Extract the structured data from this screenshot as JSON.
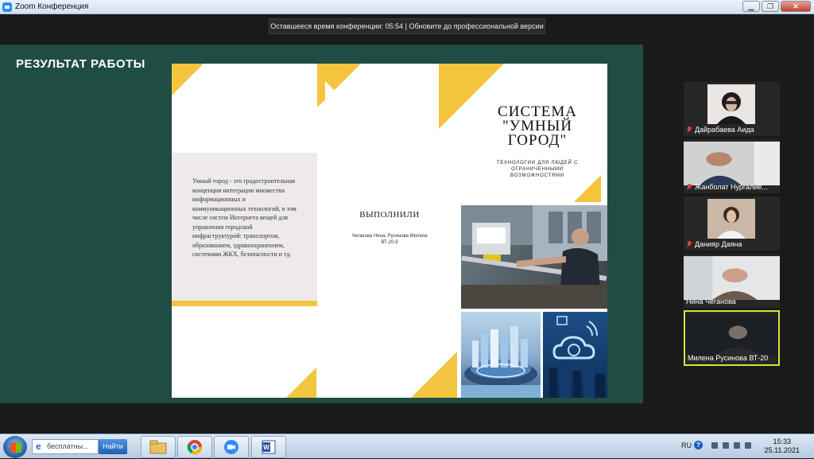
{
  "window": {
    "title": "Zoom Конференция"
  },
  "banner": {
    "text": "Оставшееся время конференции: 05:54 | Обновите до профессиональной версии"
  },
  "slide": {
    "heading": "РЕЗУЛЬТАТ РАБОТЫ"
  },
  "brochure": {
    "description": "Умный город - это градостроительная концепция интеграции множества информационных и коммуникационных технологий, в том числе систем Интернета вещей для управления городской инфраструктурой: транспортом, образованием, здравоохранением, системами ЖКХ, безопасности и тд.",
    "done_title": "ВЫПОЛНИЛИ",
    "done_names": "Чеганова Нина, Русинова Милена",
    "done_group": "ВТ-20-9",
    "title_line1": "СИСТЕМА",
    "title_line2": "\"УМНЫЙ",
    "title_line3": "ГОРОД\"",
    "subtitle": "ТЕХНОЛОГИИ ДЛЯ ЛЮДЕЙ С ОГРАНИЧЕННЫМИ ВОЗМОЖНОСТЯМИ",
    "accent": "#f3c53f"
  },
  "participants": [
    {
      "name": "Дайрабаева Аида",
      "muted": true
    },
    {
      "name": "Жанболат Нургалие...",
      "muted": true
    },
    {
      "name": "Данияр Даяна",
      "muted": true
    },
    {
      "name": "Нина Чеганова",
      "muted": false
    },
    {
      "name": "Милена Русинова ВТ-20",
      "muted": false,
      "active_speaker": true
    }
  ],
  "taskbar": {
    "search_value": "бесплатны...",
    "find_label": "Найти",
    "lang": "RU",
    "time": "15:33",
    "date": "25.11.2021"
  }
}
